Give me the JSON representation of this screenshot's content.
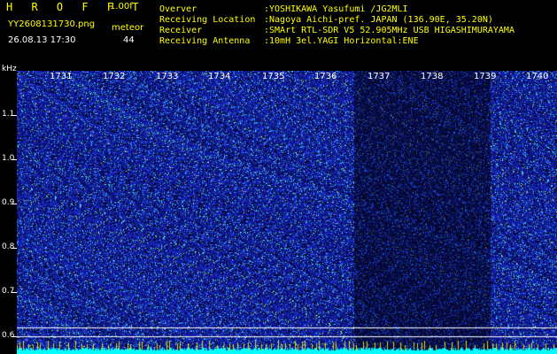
{
  "header": {
    "logo": "H R O F F T",
    "version": "1.00f",
    "filename": "YY2608131730.png",
    "meteor_label": "meteor",
    "datetime": "26.08.13 17:30",
    "meteor_count": "44"
  },
  "station": [
    {
      "key": "Overver",
      "value": ":YOSHIKAWA Yasufumi /JG2MLI"
    },
    {
      "key": "Receiving Location",
      "value": ":Nagoya Aichi-pref. JAPAN (136.90E, 35.20N)"
    },
    {
      "key": "Receiver",
      "value": ":SMArt RTL-SDR V5 52.905MHz USB HIGASHIMURAYAMA"
    },
    {
      "key": "Receiving Antenna",
      "value": ":10mH 3el.YAGI Horizontal:ENE"
    }
  ],
  "axis": {
    "y_unit": "kHz",
    "y_ticks": [
      "1.1",
      "1.0",
      "0.9",
      "0.8",
      "0.7",
      "0.6"
    ],
    "x_ticks": [
      "1731",
      "1732",
      "1733",
      "1734",
      "1735",
      "1736",
      "1737",
      "1738",
      "1739",
      "1740"
    ]
  },
  "colors": {
    "background": "#000000",
    "noise": "#1a2bd8",
    "text_yellow": "#ffff00",
    "baseline_cyan": "#00ffff"
  }
}
